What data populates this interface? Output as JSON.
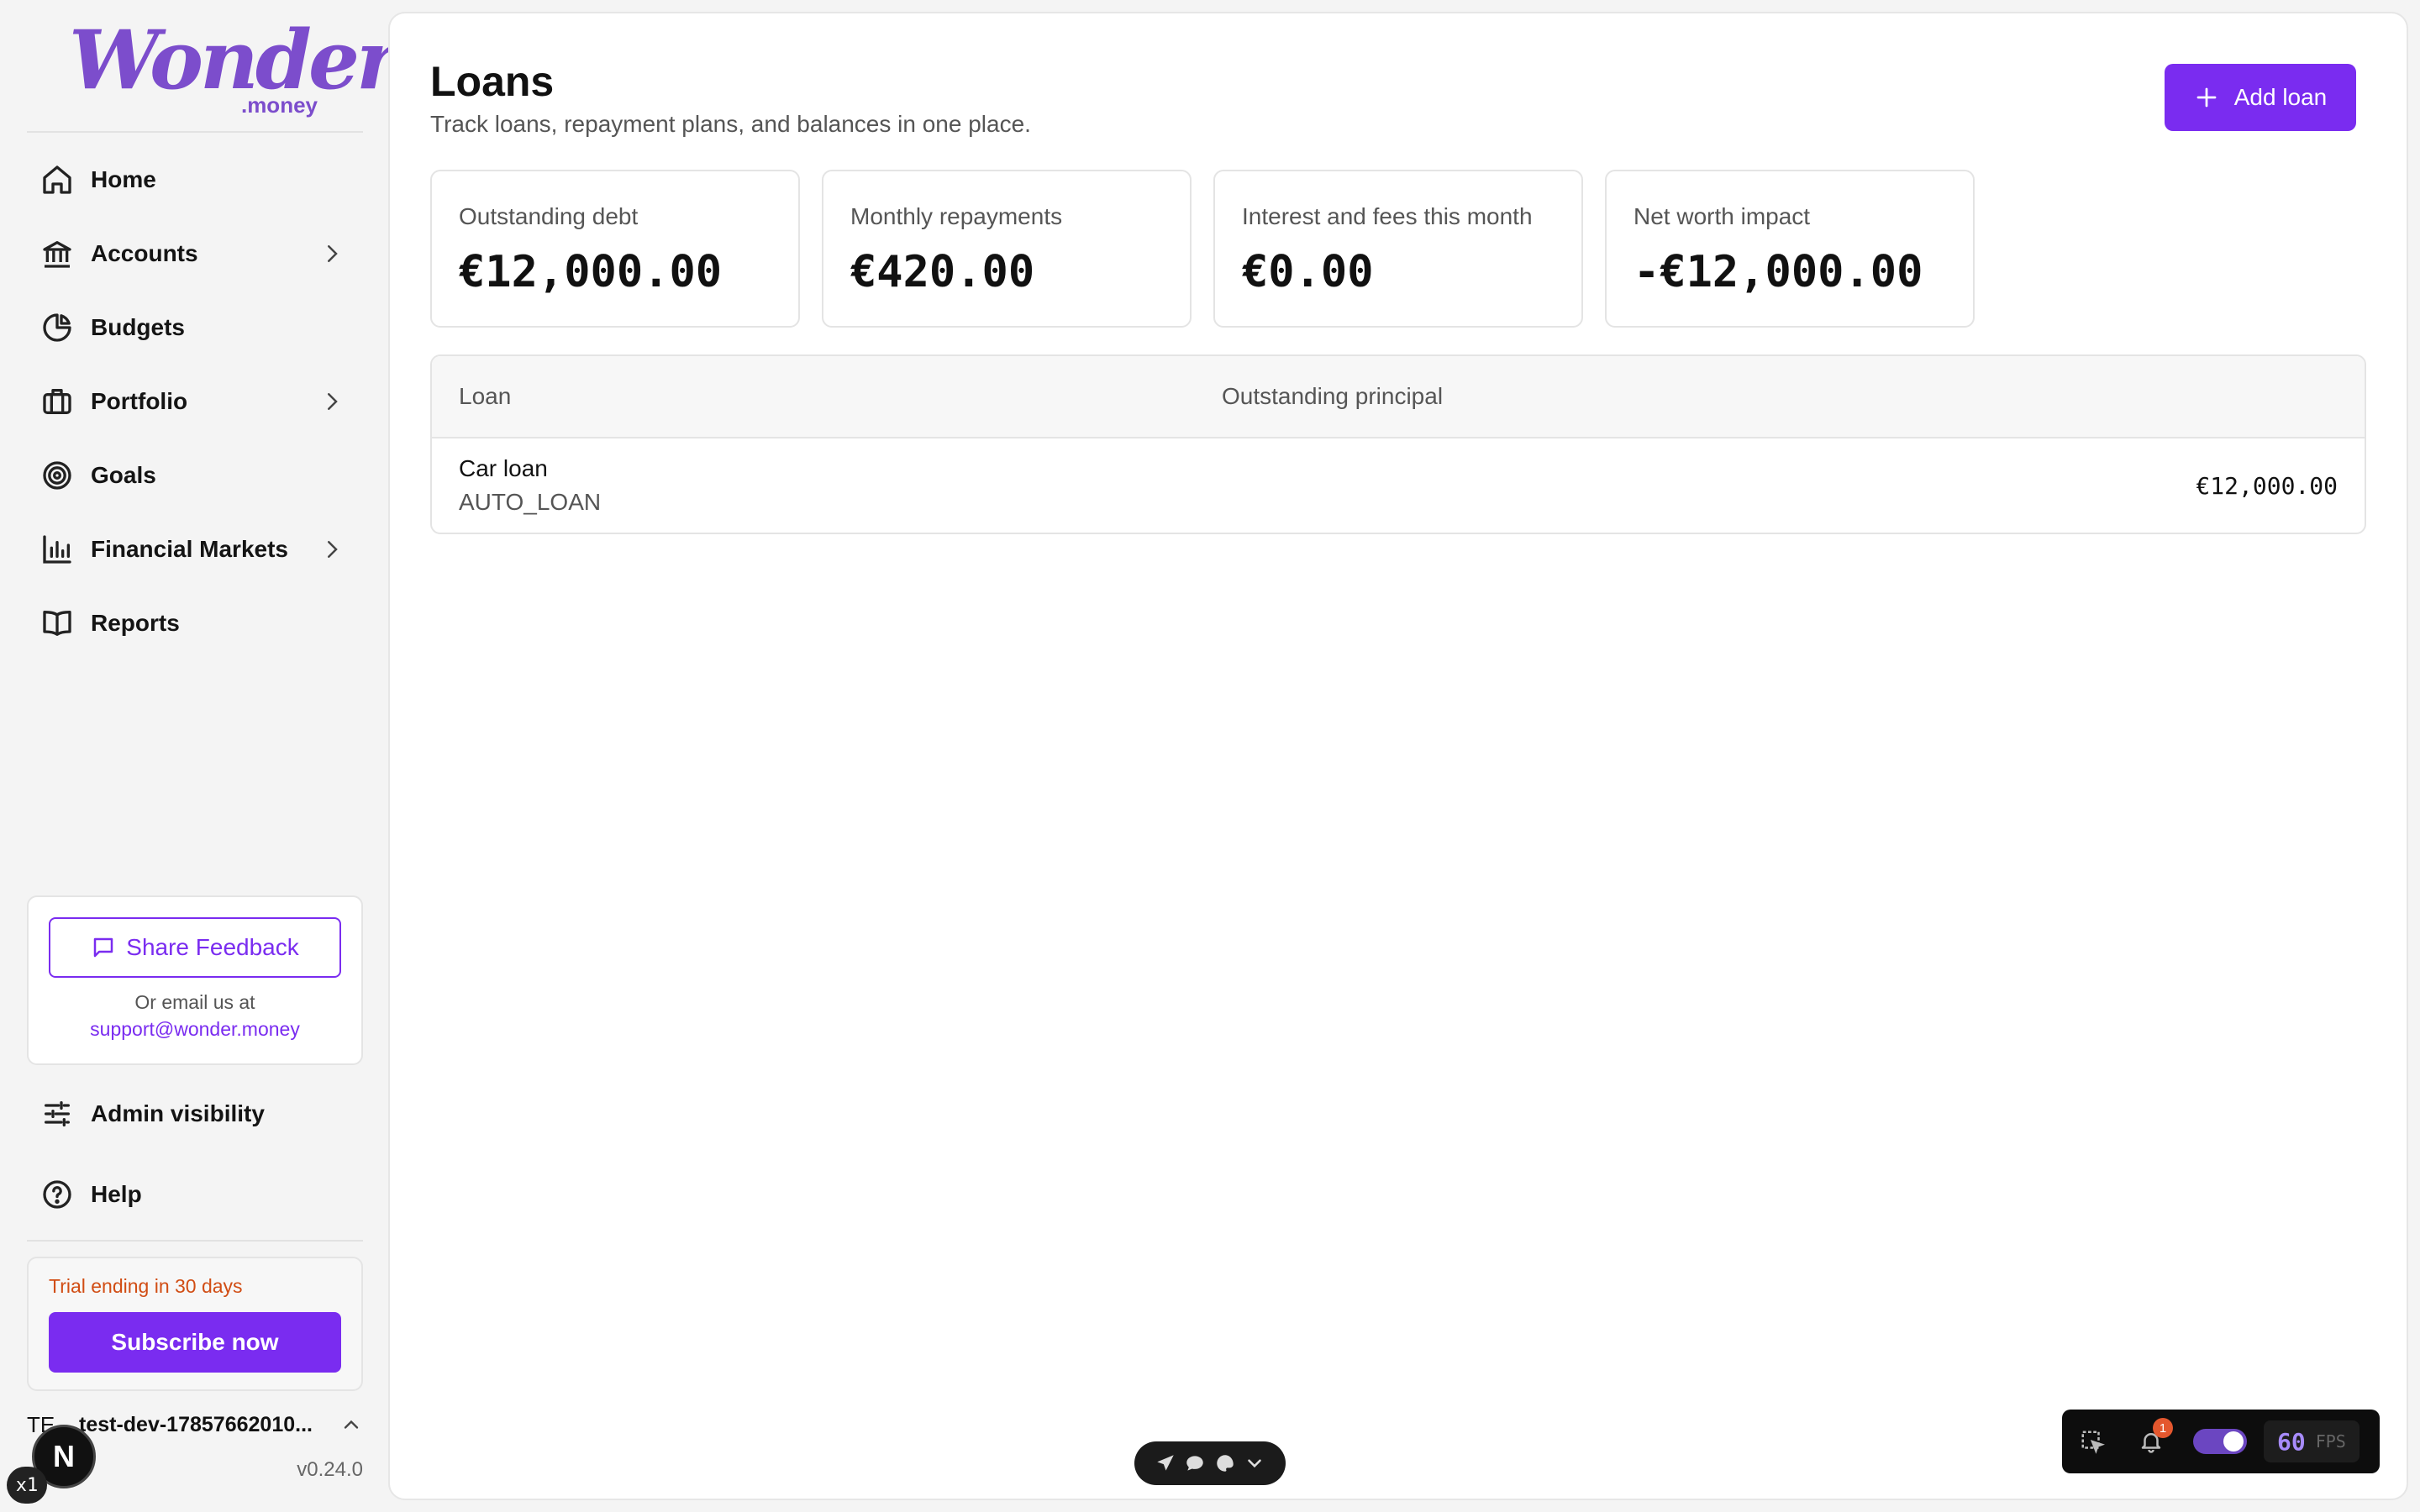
{
  "brand": {
    "logo_word": "Wonder",
    "logo_suffix": ".money",
    "accent": "#7a2cf0"
  },
  "sidebar": {
    "items": [
      {
        "label": "Home",
        "icon": "home-icon"
      },
      {
        "label": "Accounts",
        "icon": "bank-icon",
        "has_children": true
      },
      {
        "label": "Budgets",
        "icon": "pie-chart-icon"
      },
      {
        "label": "Portfolio",
        "icon": "briefcase-icon",
        "has_children": true
      },
      {
        "label": "Goals",
        "icon": "target-icon"
      },
      {
        "label": "Financial Markets",
        "icon": "bar-chart-icon",
        "has_children": true
      },
      {
        "label": "Reports",
        "icon": "book-icon"
      }
    ],
    "feedback": {
      "button_label": "Share Feedback",
      "note": "Or email us at",
      "email": "support@wonder.money"
    },
    "bottom_items": [
      {
        "label": "Admin visibility",
        "icon": "sliders-icon"
      },
      {
        "label": "Help",
        "icon": "help-circle-icon"
      }
    ],
    "trial": {
      "text": "Trial ending in 30 days",
      "button_label": "Subscribe now"
    },
    "user": {
      "initials": "TE",
      "name": "test-dev-17857662010..."
    },
    "version": "v0.24.0"
  },
  "page": {
    "title": "Loans",
    "subtitle": "Track loans, repayment plans, and balances in one place.",
    "add_button_label": "Add loan"
  },
  "stats": [
    {
      "label": "Outstanding debt",
      "value": "€12,000.00"
    },
    {
      "label": "Monthly repayments",
      "value": "€420.00"
    },
    {
      "label": "Interest and fees this month",
      "value": "€0.00"
    },
    {
      "label": "Net worth impact",
      "value": "-€12,000.00"
    }
  ],
  "loans_table": {
    "columns": [
      "Loan",
      "Outstanding principal"
    ],
    "rows": [
      {
        "name": "Car loan",
        "type": "AUTO_LOAN",
        "principal": "€12,000.00"
      }
    ]
  },
  "devtools": {
    "next_badge": "N",
    "zoom_badge": "x1",
    "notification_count": "1",
    "fps_value": "60",
    "fps_unit": "FPS"
  }
}
